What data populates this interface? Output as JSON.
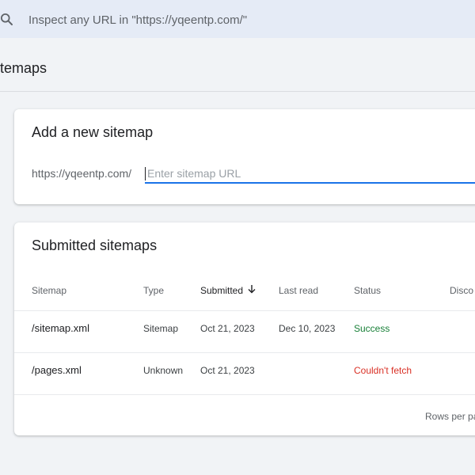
{
  "search": {
    "placeholder": "Inspect any URL in \"https://yqeentp.com/\""
  },
  "page": {
    "title": "itemaps"
  },
  "add_sitemap": {
    "title": "Add a new sitemap",
    "prefix": "https://yqeentp.com/",
    "placeholder": "Enter sitemap URL",
    "value": ""
  },
  "submitted": {
    "title": "Submitted sitemaps",
    "columns": {
      "sitemap": "Sitemap",
      "type": "Type",
      "submitted": "Submitted",
      "last_read": "Last read",
      "status": "Status",
      "discovered": "Disco"
    },
    "rows": [
      {
        "sitemap": "/sitemap.xml",
        "type": "Sitemap",
        "submitted": "Oct 21, 2023",
        "last_read": "Dec 10, 2023",
        "status": "Success"
      },
      {
        "sitemap": "/pages.xml",
        "type": "Unknown",
        "submitted": "Oct 21, 2023",
        "last_read": "",
        "status": "Couldn't fetch"
      }
    ],
    "footer": {
      "rows_per_page_label": "Rows per pa"
    }
  },
  "colors": {
    "accent": "#1a73e8",
    "success": "#188038",
    "error": "#d93025",
    "search_bg": "#e5ebf6",
    "page_bg": "#f1f3f6"
  },
  "icons": {
    "search": "search-icon",
    "sort": "arrow-down-icon"
  }
}
